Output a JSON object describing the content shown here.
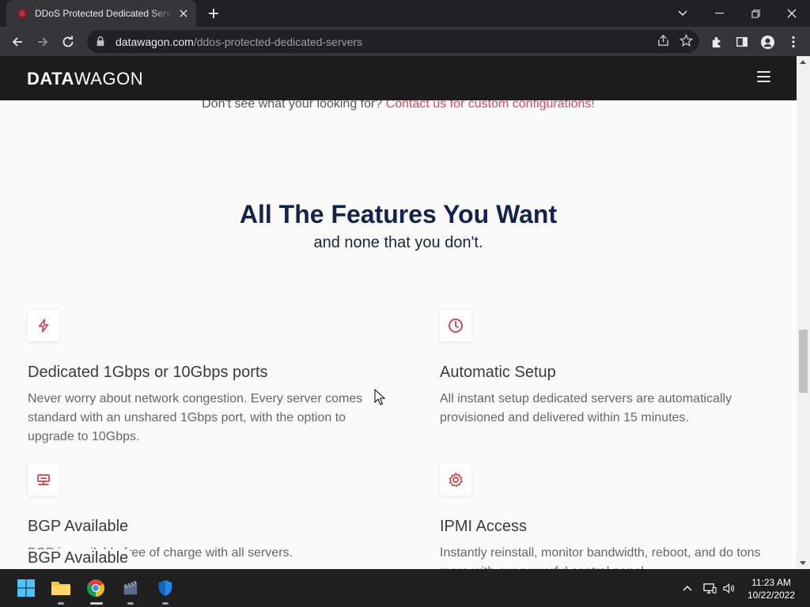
{
  "browser": {
    "tab_title": "DDoS Protected Dedicated Servers",
    "url_domain": "datawagon.com",
    "url_path": "/ddos-protected-dedicated-servers"
  },
  "site": {
    "logo_bold": "DATA",
    "logo_light": "WAGON",
    "contact_text": "Don't see what your looking for?",
    "contact_link": "Contact us for custom configurations!",
    "features_title": "All The Features You Want",
    "features_subtitle": "and none that you don't.",
    "features": [
      {
        "icon": "lightning-bolt-icon",
        "title": "Dedicated 1Gbps or 10Gbps ports",
        "desc": "Never worry about network congestion. Every server comes standard with an unshared 1Gbps port, with the option to upgrade to 10Gbps."
      },
      {
        "icon": "clock-icon",
        "title": "Automatic Setup",
        "desc": "All instant setup dedicated servers are automatically provisioned and delivered within 15 minutes."
      },
      {
        "icon": "network-icon",
        "title": "BGP Available",
        "desc": "BGP is available free of charge with all servers."
      },
      {
        "icon": "gear-icon",
        "title": "IPMI Access",
        "desc": "Instantly reinstall, monitor bandwidth, reboot, and do tons more with our powerful control panel."
      }
    ],
    "overlay_label": "BGP Available"
  },
  "taskbar": {
    "time": "11:23 AM",
    "date": "10/22/2022"
  },
  "colors": {
    "accent": "#e0465e",
    "title": "#14234b",
    "nav": "#1c1c1c"
  }
}
